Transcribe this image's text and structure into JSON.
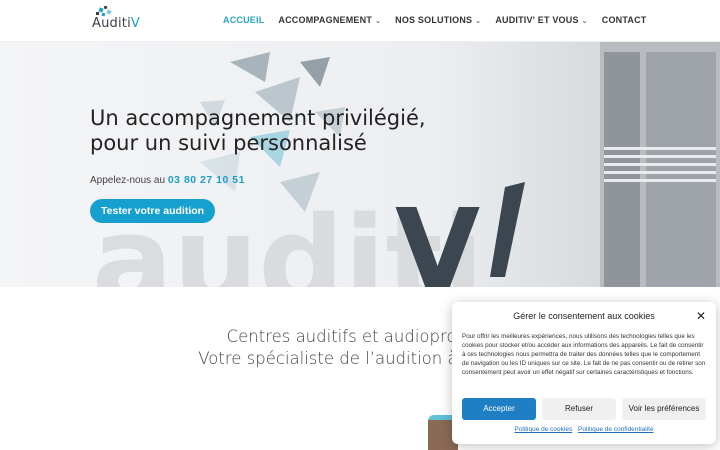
{
  "header": {
    "logo_text_main": "Auditi",
    "logo_text_accent": "V",
    "nav": [
      {
        "label": "Accueil",
        "active": true,
        "dropdown": false
      },
      {
        "label": "Accompagnement",
        "active": false,
        "dropdown": true
      },
      {
        "label": "Nos solutions",
        "active": false,
        "dropdown": true
      },
      {
        "label": "Auditiv' et vous",
        "active": false,
        "dropdown": true
      },
      {
        "label": "Contact",
        "active": false,
        "dropdown": false
      }
    ]
  },
  "hero": {
    "title_line1": "Un accompagnement privilégié,",
    "title_line2": "pour un suivi personnalisé",
    "phone_prefix": "Appelez-nous au",
    "phone_number": "03 80 27 10 51",
    "cta_label": "Tester votre audition"
  },
  "section": {
    "title_line1": "Centres auditifs et audioproth",
    "title_line2": "Votre spécialiste de l’audition à Cher"
  },
  "cookie": {
    "title": "Gérer le consentement aux cookies",
    "text": "Pour offrir les meilleures expériences, nous utilisons des technologies telles que les cookies pour stocker et/ou accéder aux informations des appareils. Le fait de consentir à ces technologies nous permettra de traiter des données telles que le comportement de navigation ou les ID uniques sur ce site. Le fait de ne pas consentir ou de retirer son consentement peut avoir un effet négatif sur certaines caractéristiques et fonctions.",
    "accept_label": "Accepter",
    "refuse_label": "Refuser",
    "prefs_label": "Voir les préférences",
    "link_cookies": "Politique de cookies",
    "link_privacy": "Politique de confidentialité"
  },
  "colors": {
    "accent": "#1a9fc8",
    "cta": "#16a0d0",
    "accept": "#1f7fc4"
  }
}
